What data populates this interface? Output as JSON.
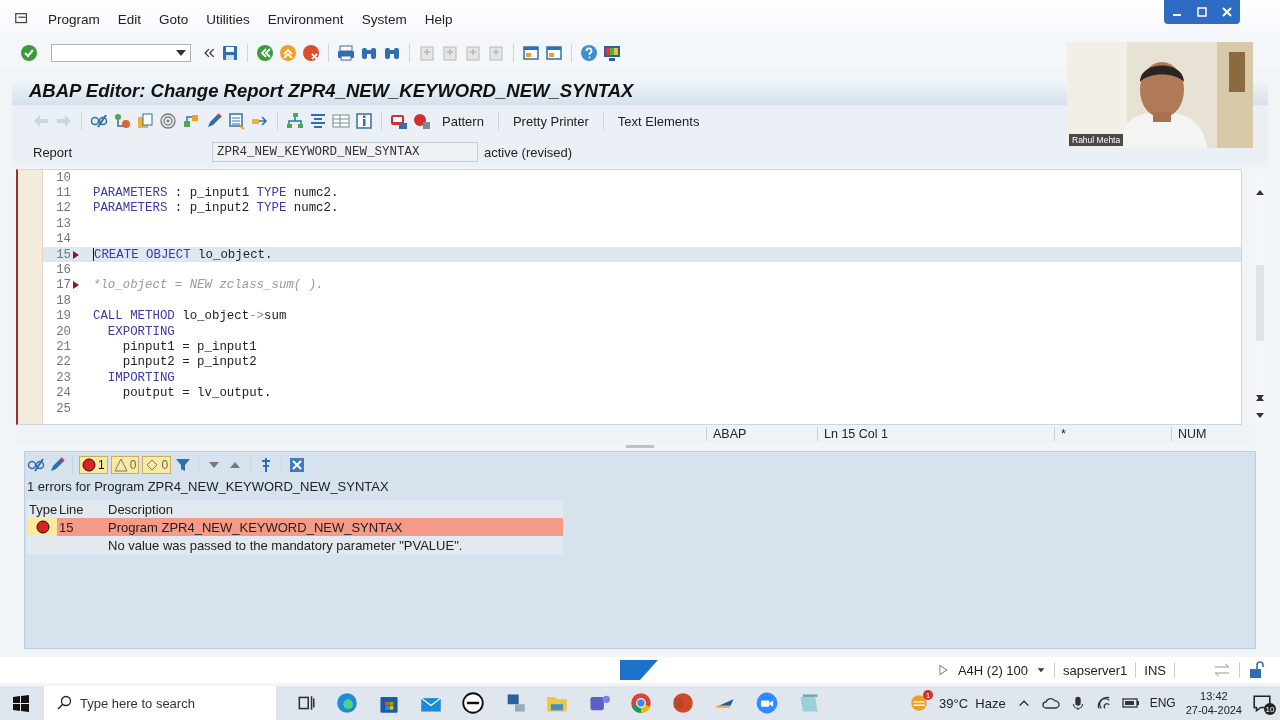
{
  "menu": [
    "Program",
    "Edit",
    "Goto",
    "Utilities",
    "Environment",
    "System",
    "Help"
  ],
  "title": "ABAP Editor: Change Report ZPR4_NEW_KEYWORD_NEW_SYNTAX",
  "app_toolbar": {
    "buttons": [
      "Pattern",
      "Pretty Printer",
      "Text Elements"
    ]
  },
  "report": {
    "label": "Report",
    "value": "ZPR4_NEW_KEYWORD_NEW_SYNTAX",
    "status": "active (revised)"
  },
  "editor": {
    "lines": [
      {
        "number": "10",
        "marker": false,
        "selected": false
      },
      {
        "number": "11",
        "marker": false,
        "selected": false,
        "tokens": [
          {
            "kind": "keyword",
            "text": "PARAMETERS"
          },
          {
            "kind": "plain",
            "text": " : p_input1 "
          },
          {
            "kind": "keyword",
            "text": "TYPE"
          },
          {
            "kind": "plain",
            "text": " numc2."
          }
        ]
      },
      {
        "number": "12",
        "marker": false,
        "selected": false,
        "tokens": [
          {
            "kind": "keyword",
            "text": "PARAMETERS"
          },
          {
            "kind": "plain",
            "text": " : p_input2 "
          },
          {
            "kind": "keyword",
            "text": "TYPE"
          },
          {
            "kind": "plain",
            "text": " numc2."
          }
        ]
      },
      {
        "number": "13",
        "marker": false,
        "selected": false
      },
      {
        "number": "14",
        "marker": false,
        "selected": false
      },
      {
        "number": "15",
        "marker": true,
        "selected": true,
        "tokens": [
          {
            "kind": "keyword",
            "text": "CREATE"
          },
          {
            "kind": "keyword",
            "text": " OBJECT"
          },
          {
            "kind": "plain",
            "text": " lo_object."
          }
        ]
      },
      {
        "number": "16",
        "marker": false,
        "selected": false
      },
      {
        "number": "17",
        "marker": true,
        "selected": false,
        "tokens": [
          {
            "kind": "comment",
            "text": "*lo_object = NEW zclass_sum( )."
          }
        ]
      },
      {
        "number": "18",
        "marker": false,
        "selected": false
      },
      {
        "number": "19",
        "marker": false,
        "selected": false,
        "tokens": [
          {
            "kind": "keyword",
            "text": "CALL METHOD"
          },
          {
            "kind": "plain",
            "text": " lo_object"
          },
          {
            "kind": "operator",
            "text": "->"
          },
          {
            "kind": "plain",
            "text": "sum"
          }
        ]
      },
      {
        "number": "20",
        "marker": false,
        "selected": false,
        "tokens": [
          {
            "kind": "keyword",
            "text": "  EXPORTING"
          }
        ]
      },
      {
        "number": "21",
        "marker": false,
        "selected": false,
        "tokens": [
          {
            "kind": "plain",
            "text": "    pinput1 = p_input1"
          }
        ]
      },
      {
        "number": "22",
        "marker": false,
        "selected": false,
        "tokens": [
          {
            "kind": "plain",
            "text": "    pinput2 = p_input2"
          }
        ]
      },
      {
        "number": "23",
        "marker": false,
        "selected": false,
        "tokens": [
          {
            "kind": "keyword",
            "text": "  IMPORTING"
          }
        ]
      },
      {
        "number": "24",
        "marker": false,
        "selected": false,
        "tokens": [
          {
            "kind": "plain",
            "text": "    poutput = lv_output."
          }
        ]
      },
      {
        "number": "25",
        "marker": false,
        "selected": false
      }
    ]
  },
  "editor_status": {
    "language": "ABAP",
    "position": "Ln  15 Col   1",
    "modified": "*",
    "num": "NUM"
  },
  "errors": {
    "counts": {
      "errors": "1",
      "warnings": "0",
      "infos": "0"
    },
    "heading": "1 errors for Program ZPR4_NEW_KEYWORD_NEW_SYNTAX",
    "columns": [
      "Type",
      "Line",
      "Description"
    ],
    "rows": [
      {
        "line": "15",
        "program": "Program ZPR4_NEW_KEYWORD_NEW_SYNTAX",
        "message": "No value was passed to the mandatory parameter \"PVALUE\".",
        "selected": true
      }
    ]
  },
  "status_bar": {
    "system": "A4H (2) 100",
    "server": "sapserver1",
    "mode": "INS"
  },
  "webcam": {
    "kind": "picture",
    "name": "Rahul Mehta"
  },
  "taskbar": {
    "search_placeholder": "Type here to search",
    "weather_badge": "1",
    "weather": "39°C  Haze",
    "language": "ENG",
    "time": "13:42",
    "date": "27-04-2024",
    "notifications": "10"
  }
}
